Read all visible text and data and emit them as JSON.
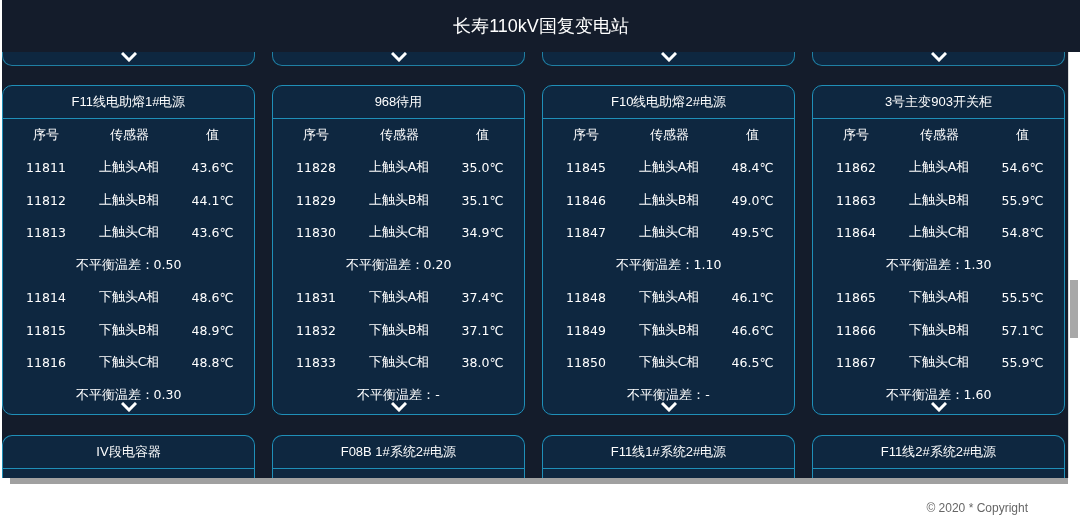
{
  "header": {
    "title": "长寿110kV国复变电站"
  },
  "cards": [
    {
      "title": "F11线电助熔1#电源",
      "columns": [
        "序号",
        "传感器",
        "值"
      ],
      "rows": [
        {
          "kind": "reading",
          "id": "11811",
          "sensor": "上触头A相",
          "value": "43.6℃"
        },
        {
          "kind": "reading",
          "id": "11812",
          "sensor": "上触头B相",
          "value": "44.1℃"
        },
        {
          "kind": "reading",
          "id": "11813",
          "sensor": "上触头C相",
          "value": "43.6℃"
        },
        {
          "kind": "imbalance",
          "text": "不平衡温差：0.50"
        },
        {
          "kind": "reading",
          "id": "11814",
          "sensor": "下触头A相",
          "value": "48.6℃"
        },
        {
          "kind": "reading",
          "id": "11815",
          "sensor": "下触头B相",
          "value": "48.9℃"
        },
        {
          "kind": "reading",
          "id": "11816",
          "sensor": "下触头C相",
          "value": "48.8℃"
        },
        {
          "kind": "imbalance",
          "text": "不平衡温差：0.30"
        }
      ]
    },
    {
      "title": "968待用",
      "columns": [
        "序号",
        "传感器",
        "值"
      ],
      "rows": [
        {
          "kind": "reading",
          "id": "11828",
          "sensor": "上触头A相",
          "value": "35.0℃"
        },
        {
          "kind": "reading",
          "id": "11829",
          "sensor": "上触头B相",
          "value": "35.1℃"
        },
        {
          "kind": "reading",
          "id": "11830",
          "sensor": "上触头C相",
          "value": "34.9℃"
        },
        {
          "kind": "imbalance",
          "text": "不平衡温差：0.20"
        },
        {
          "kind": "reading",
          "id": "11831",
          "sensor": "下触头A相",
          "value": "37.4℃"
        },
        {
          "kind": "reading",
          "id": "11832",
          "sensor": "下触头B相",
          "value": "37.1℃"
        },
        {
          "kind": "reading",
          "id": "11833",
          "sensor": "下触头C相",
          "value": "38.0℃"
        },
        {
          "kind": "imbalance",
          "text": "不平衡温差：-"
        }
      ]
    },
    {
      "title": "F10线电助熔2#电源",
      "columns": [
        "序号",
        "传感器",
        "值"
      ],
      "rows": [
        {
          "kind": "reading",
          "id": "11845",
          "sensor": "上触头A相",
          "value": "48.4℃"
        },
        {
          "kind": "reading",
          "id": "11846",
          "sensor": "上触头B相",
          "value": "49.0℃"
        },
        {
          "kind": "reading",
          "id": "11847",
          "sensor": "上触头C相",
          "value": "49.5℃"
        },
        {
          "kind": "imbalance",
          "text": "不平衡温差：1.10"
        },
        {
          "kind": "reading",
          "id": "11848",
          "sensor": "下触头A相",
          "value": "46.1℃"
        },
        {
          "kind": "reading",
          "id": "11849",
          "sensor": "下触头B相",
          "value": "46.6℃"
        },
        {
          "kind": "reading",
          "id": "11850",
          "sensor": "下触头C相",
          "value": "46.5℃"
        },
        {
          "kind": "imbalance",
          "text": "不平衡温差：-"
        }
      ]
    },
    {
      "title": "3号主变903开关柜",
      "columns": [
        "序号",
        "传感器",
        "值"
      ],
      "rows": [
        {
          "kind": "reading",
          "id": "11862",
          "sensor": "上触头A相",
          "value": "54.6℃"
        },
        {
          "kind": "reading",
          "id": "11863",
          "sensor": "上触头B相",
          "value": "55.9℃"
        },
        {
          "kind": "reading",
          "id": "11864",
          "sensor": "上触头C相",
          "value": "54.8℃"
        },
        {
          "kind": "imbalance",
          "text": "不平衡温差：1.30"
        },
        {
          "kind": "reading",
          "id": "11865",
          "sensor": "下触头A相",
          "value": "55.5℃"
        },
        {
          "kind": "reading",
          "id": "11866",
          "sensor": "下触头B相",
          "value": "57.1℃"
        },
        {
          "kind": "reading",
          "id": "11867",
          "sensor": "下触头C相",
          "value": "55.9℃"
        },
        {
          "kind": "imbalance",
          "text": "不平衡温差：1.60"
        }
      ]
    }
  ],
  "next_cards": [
    {
      "title": "IV段电容器"
    },
    {
      "title": "F08B 1#系统2#电源"
    },
    {
      "title": "F11线1#系统2#电源"
    },
    {
      "title": "F11线2#系统2#电源"
    }
  ],
  "footer": {
    "copyright": "© 2020 * Copyright"
  }
}
